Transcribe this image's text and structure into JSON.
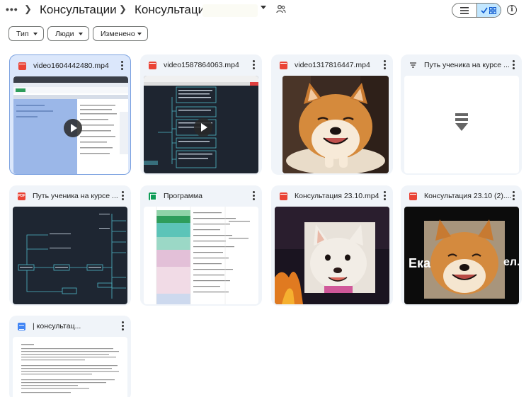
{
  "header": {
    "more_label": "•••",
    "breadcrumb": [
      "Консультации",
      "Консультация"
    ]
  },
  "filters": [
    {
      "label": "Тип"
    },
    {
      "label": "Люди"
    },
    {
      "label": "Изменено"
    }
  ],
  "files": [
    {
      "name": "video1604442480.mp4",
      "type": "video",
      "selected": true
    },
    {
      "name": "video1587864063.mp4",
      "type": "video"
    },
    {
      "name": "video1317816447.mp4",
      "type": "video"
    },
    {
      "name": "Путь ученика на курсе ...",
      "type": "stack"
    },
    {
      "name": "Путь ученика на курсе ...",
      "type": "pdf",
      "badge": "PDF"
    },
    {
      "name": "Программа",
      "type": "sheet"
    },
    {
      "name": "Консультация 23.10.mp4",
      "type": "video"
    },
    {
      "name": "Консультация 23.10 (2)....",
      "type": "video",
      "overlay": "Ека",
      "overlay2": "ел.."
    },
    {
      "name": "| консультац...",
      "type": "doc"
    }
  ],
  "colors": {
    "card_bg": "#f0f4f9",
    "selected_bg": "#dbe7fb",
    "toggle_active": "#c2e7ff",
    "video_icon": "#ea4335"
  }
}
